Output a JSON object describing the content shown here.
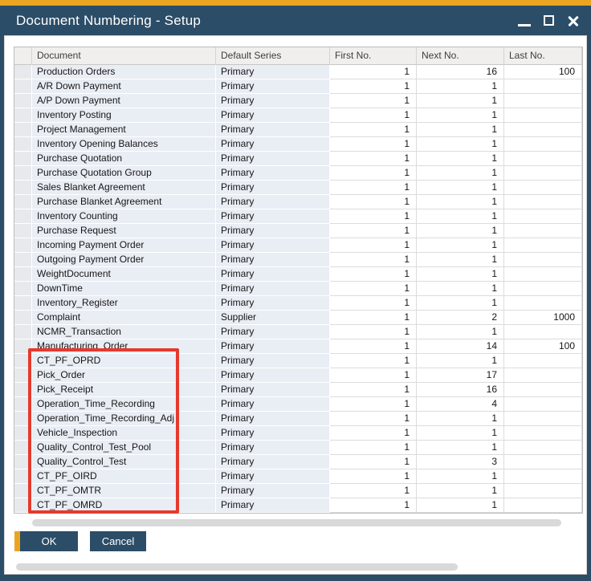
{
  "window": {
    "title": "Document Numbering - Setup",
    "control_icons": [
      "minimize-icon",
      "maximize-icon",
      "close-icon"
    ]
  },
  "colors": {
    "accent_gold": "#E9A521",
    "titlebar_blue": "#2B4D68",
    "annotation_red": "#E5392E",
    "row_fill": "#E9EDF4",
    "header_fill": "#F0EFEE"
  },
  "table": {
    "columns": [
      "Document",
      "Default Series",
      "First No.",
      "Next No.",
      "Last No."
    ],
    "rows": [
      {
        "document": "Production Orders",
        "default_series": "Primary",
        "first_no": "1",
        "next_no": "16",
        "last_no": "100"
      },
      {
        "document": "A/R Down Payment",
        "default_series": "Primary",
        "first_no": "1",
        "next_no": "1",
        "last_no": ""
      },
      {
        "document": "A/P Down Payment",
        "default_series": "Primary",
        "first_no": "1",
        "next_no": "1",
        "last_no": ""
      },
      {
        "document": "Inventory Posting",
        "default_series": "Primary",
        "first_no": "1",
        "next_no": "1",
        "last_no": ""
      },
      {
        "document": "Project Management",
        "default_series": "Primary",
        "first_no": "1",
        "next_no": "1",
        "last_no": ""
      },
      {
        "document": "Inventory Opening Balances",
        "default_series": "Primary",
        "first_no": "1",
        "next_no": "1",
        "last_no": ""
      },
      {
        "document": "Purchase Quotation",
        "default_series": "Primary",
        "first_no": "1",
        "next_no": "1",
        "last_no": ""
      },
      {
        "document": "Purchase Quotation Group",
        "default_series": "Primary",
        "first_no": "1",
        "next_no": "1",
        "last_no": ""
      },
      {
        "document": "Sales Blanket Agreement",
        "default_series": "Primary",
        "first_no": "1",
        "next_no": "1",
        "last_no": ""
      },
      {
        "document": "Purchase Blanket Agreement",
        "default_series": "Primary",
        "first_no": "1",
        "next_no": "1",
        "last_no": ""
      },
      {
        "document": "Inventory Counting",
        "default_series": "Primary",
        "first_no": "1",
        "next_no": "1",
        "last_no": ""
      },
      {
        "document": "Purchase Request",
        "default_series": "Primary",
        "first_no": "1",
        "next_no": "1",
        "last_no": ""
      },
      {
        "document": "Incoming Payment Order",
        "default_series": "Primary",
        "first_no": "1",
        "next_no": "1",
        "last_no": ""
      },
      {
        "document": "Outgoing Payment Order",
        "default_series": "Primary",
        "first_no": "1",
        "next_no": "1",
        "last_no": ""
      },
      {
        "document": "WeightDocument",
        "default_series": "Primary",
        "first_no": "1",
        "next_no": "1",
        "last_no": ""
      },
      {
        "document": "DownTime",
        "default_series": "Primary",
        "first_no": "1",
        "next_no": "1",
        "last_no": ""
      },
      {
        "document": "Inventory_Register",
        "default_series": "Primary",
        "first_no": "1",
        "next_no": "1",
        "last_no": ""
      },
      {
        "document": "Complaint",
        "default_series": "Supplier",
        "first_no": "1",
        "next_no": "2",
        "last_no": "1000"
      },
      {
        "document": "NCMR_Transaction",
        "default_series": "Primary",
        "first_no": "1",
        "next_no": "1",
        "last_no": ""
      },
      {
        "document": "Manufacturing_Order",
        "default_series": "Primary",
        "first_no": "1",
        "next_no": "14",
        "last_no": "100"
      },
      {
        "document": "CT_PF_OPRD",
        "default_series": "Primary",
        "first_no": "1",
        "next_no": "1",
        "last_no": ""
      },
      {
        "document": "Pick_Order",
        "default_series": "Primary",
        "first_no": "1",
        "next_no": "17",
        "last_no": ""
      },
      {
        "document": "Pick_Receipt",
        "default_series": "Primary",
        "first_no": "1",
        "next_no": "16",
        "last_no": ""
      },
      {
        "document": "Operation_Time_Recording",
        "default_series": "Primary",
        "first_no": "1",
        "next_no": "4",
        "last_no": ""
      },
      {
        "document": "Operation_Time_Recording_Adj",
        "default_series": "Primary",
        "first_no": "1",
        "next_no": "1",
        "last_no": ""
      },
      {
        "document": "Vehicle_Inspection",
        "default_series": "Primary",
        "first_no": "1",
        "next_no": "1",
        "last_no": ""
      },
      {
        "document": "Quality_Control_Test_Pool",
        "default_series": "Primary",
        "first_no": "1",
        "next_no": "1",
        "last_no": ""
      },
      {
        "document": "Quality_Control_Test",
        "default_series": "Primary",
        "first_no": "1",
        "next_no": "3",
        "last_no": ""
      },
      {
        "document": "CT_PF_OIRD",
        "default_series": "Primary",
        "first_no": "1",
        "next_no": "1",
        "last_no": ""
      },
      {
        "document": "CT_PF_OMTR",
        "default_series": "Primary",
        "first_no": "1",
        "next_no": "1",
        "last_no": ""
      },
      {
        "document": "CT_PF_OMRD",
        "default_series": "Primary",
        "first_no": "1",
        "next_no": "1",
        "last_no": ""
      }
    ],
    "annotation": {
      "shape": "red-rectangle",
      "color": "#E5392E",
      "first_highlighted_document": "CT_PF_OPRD",
      "last_highlighted_document": "CT_PF_OMRD"
    }
  },
  "footer": {
    "ok_label": "OK",
    "cancel_label": "Cancel"
  }
}
